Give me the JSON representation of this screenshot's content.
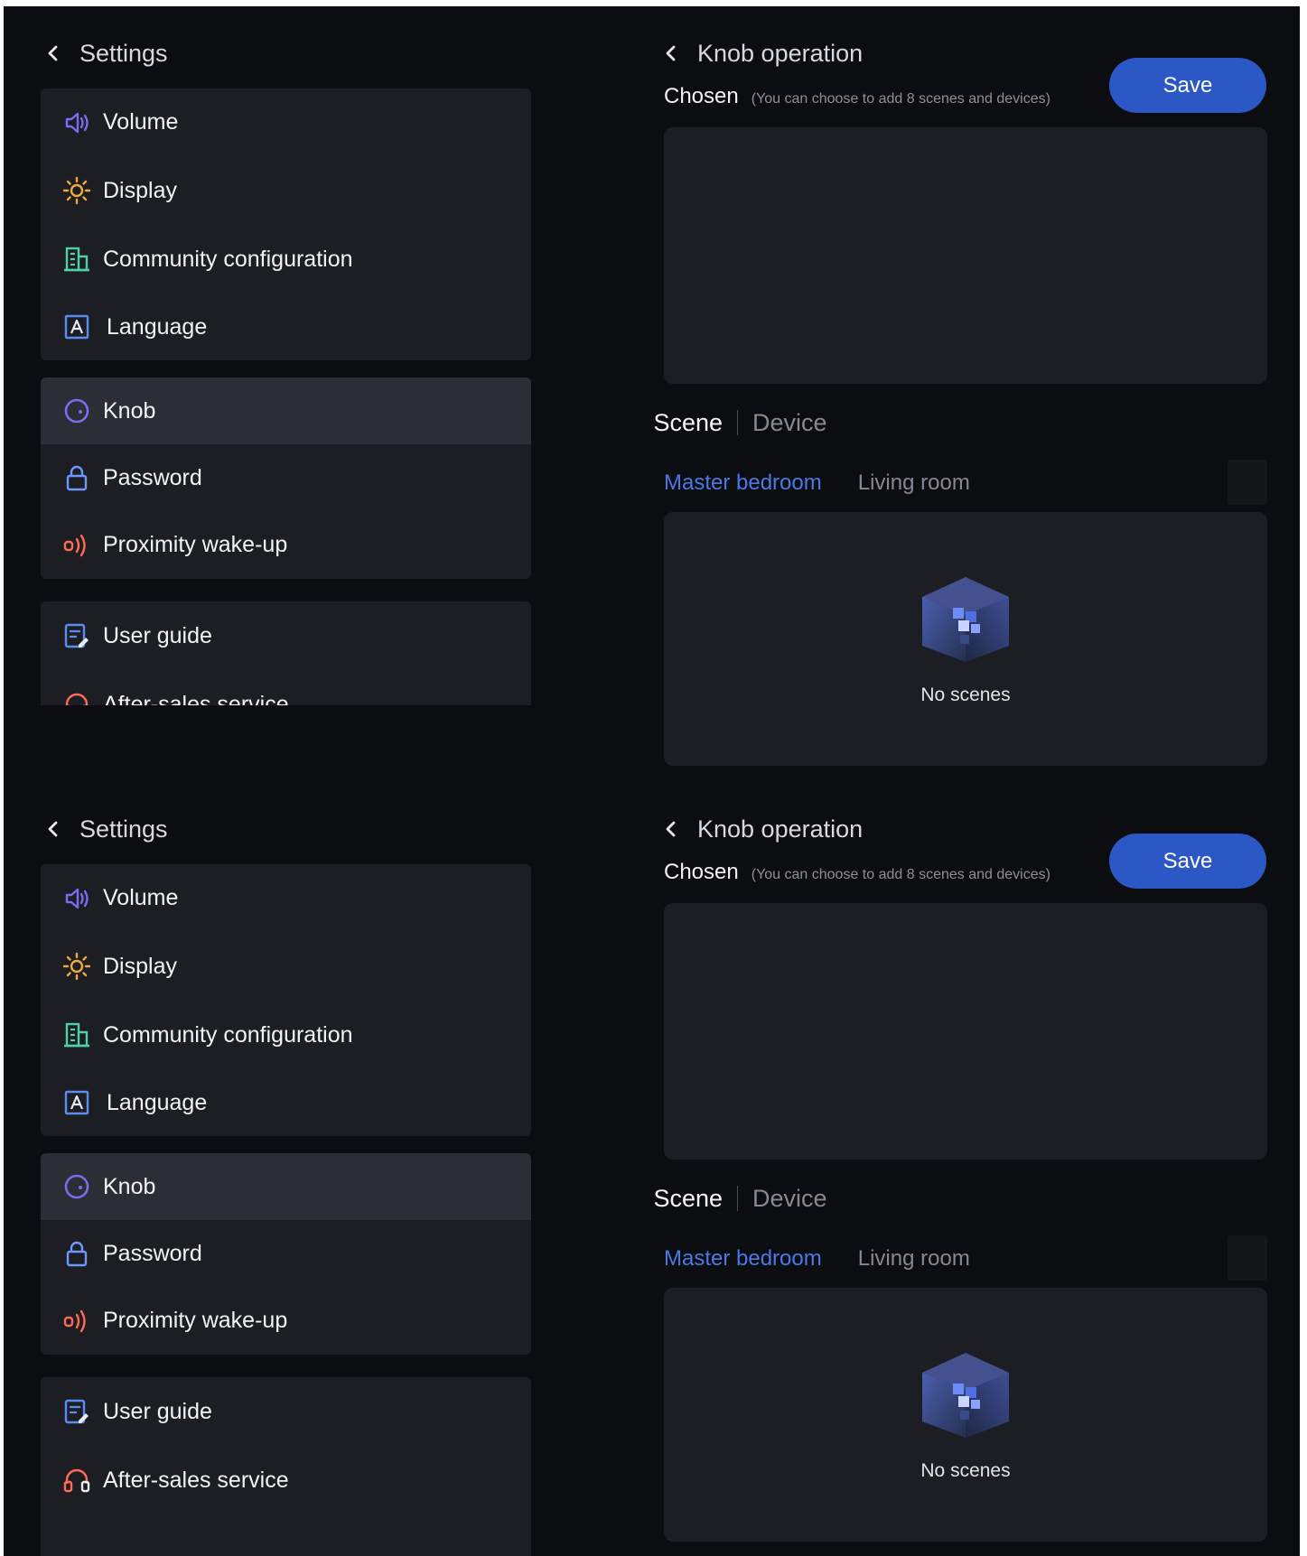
{
  "settings": {
    "title": "Settings",
    "groups": [
      {
        "items": [
          {
            "label": "Volume",
            "icon": "volume-icon"
          },
          {
            "label": "Display",
            "icon": "brightness-icon"
          },
          {
            "label": "Community configuration",
            "icon": "building-icon"
          },
          {
            "label": "Language",
            "icon": "language-icon"
          }
        ]
      },
      {
        "items": [
          {
            "label": "Knob",
            "icon": "knob-icon",
            "active": true
          },
          {
            "label": "Password",
            "icon": "lock-icon"
          },
          {
            "label": "Proximity wake-up",
            "icon": "proximity-icon"
          }
        ]
      },
      {
        "items": [
          {
            "label": "User guide",
            "icon": "guide-icon"
          },
          {
            "label": "After-sales service",
            "icon": "headset-icon"
          }
        ]
      }
    ]
  },
  "knob": {
    "title": "Knob operation",
    "chosen_label": "Chosen",
    "chosen_hint": "(You can choose to add 8 scenes and devices)",
    "save_label": "Save",
    "tabs": [
      {
        "label": "Scene",
        "active": true
      },
      {
        "label": "Device",
        "active": false
      }
    ],
    "rooms": [
      {
        "label": "Master bedroom",
        "active": true
      },
      {
        "label": "Living room",
        "active": false
      }
    ],
    "empty_text": "No scenes"
  },
  "colors": {
    "background": "#0c0d11",
    "panel": "#1c1e24",
    "active_item": "#2c2e35",
    "accent": "#2b58c4",
    "room_active": "#4a79e6",
    "volume_icon": "#7b6cf0",
    "display_icon": "#f0a93a",
    "community_icon": "#4fd0a6",
    "language_icon": "#5b8df0",
    "knob_icon": "#7a6cf5",
    "password_icon": "#6f96ff",
    "proximity_icon": "#ff6b57",
    "guide_icon": "#5b8df0",
    "headset_icon": "#ff6b57"
  }
}
